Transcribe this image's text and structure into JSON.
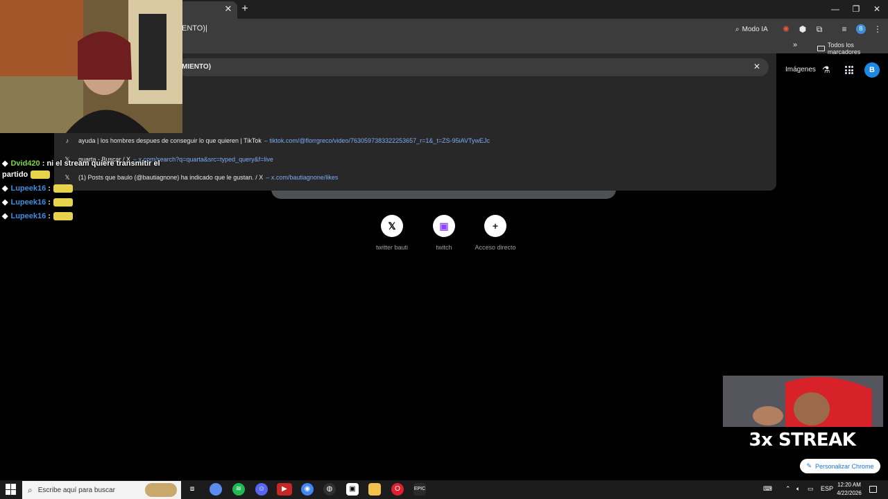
{
  "browser": {
    "omnibox_text": "ENTO)|",
    "modo_ia_label": "Modo IA",
    "profile_initial": "B",
    "bookmarks_overflow": "»",
    "bookmarks_all": "Todos los marcadores",
    "window_controls": [
      "—",
      "❐",
      "✕"
    ],
    "tab_close": "✕",
    "new_tab": "+"
  },
  "google_header": {
    "images_label": "Imágenes",
    "avatar_initial": "B"
  },
  "dropdown": {
    "query_text": "MIENTO)",
    "clear_icon": "✕",
    "suggestions": [
      {
        "icon": "tiktok-icon",
        "glyph": "♪",
        "title": "ayuda | los hombres despues de conseguir lo que quieren | TikTok",
        "separator": " – ",
        "url": "tiktok.com/@florrgreco/video/7630597383322253657_r=1&_t=ZS-95iAVTywEJc"
      },
      {
        "icon": "x-icon",
        "glyph": "𝕏",
        "title": "quarta - Buscar / X",
        "separator": " – ",
        "url": "x.com/search?q=quarta&src=typed_query&f=live"
      },
      {
        "icon": "x-icon",
        "glyph": "𝕏",
        "title": "(1) Posts que baulo (@bautiagnone) ha indicado que le gustan. / X",
        "separator": " – ",
        "url": "x.com/bautiagnone/likes"
      }
    ]
  },
  "shortcuts": [
    {
      "label": "twitter bauti",
      "glyph": "𝕏",
      "bg": "#ffffff",
      "fg": "#000000"
    },
    {
      "label": "twitch",
      "glyph": "▣",
      "bg": "#ffffff",
      "fg": "#9146ff"
    },
    {
      "label": "Acceso directo",
      "glyph": "+",
      "bg": "#ffffff",
      "fg": "#202124"
    }
  ],
  "chat": [
    {
      "user": "Dvid420",
      "user_color": "#7fd83a",
      "message": ": ni el stream quiere transmitir el",
      "emote": false
    },
    {
      "user": "",
      "user_color": "#ffffff",
      "message": "partido",
      "emote": true
    },
    {
      "user": "Lupeek16",
      "user_color": "#3f8fe0",
      "message": ":",
      "emote": true
    },
    {
      "user": "Lupeek16",
      "user_color": "#3f8fe0",
      "message": ":",
      "emote": true
    },
    {
      "user": "Lupeek16",
      "user_color": "#3f8fe0",
      "message": ":",
      "emote": true
    }
  ],
  "overlay": {
    "streak_text": "3x STREAK"
  },
  "customize_label": "Personalizar Chrome",
  "taskbar": {
    "search_placeholder": "Escribe aquí para buscar",
    "language": "ESP",
    "time": "12:20 AM",
    "date": "4/22/2026",
    "apps": [
      "task-view",
      "copilot",
      "spotify",
      "discord",
      "video-editor",
      "chrome",
      "obs",
      "capcut",
      "file-explorer",
      "opera",
      "epic-games"
    ]
  },
  "colors": {
    "accent": "#1a73e8",
    "link": "#7cacf8",
    "dropdown_bg": "#282828"
  }
}
